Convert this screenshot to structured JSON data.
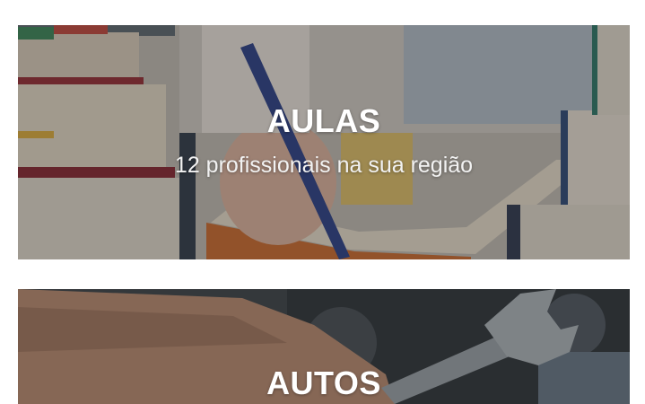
{
  "categories": [
    {
      "title": "AULAS",
      "subtitle": "12 profissionais na sua região",
      "image": "books-writing-photo"
    },
    {
      "title": "AUTOS",
      "image": "wrench-engine-photo"
    }
  ],
  "colors": {
    "overlay": "#282828",
    "text": "#ffffff"
  }
}
